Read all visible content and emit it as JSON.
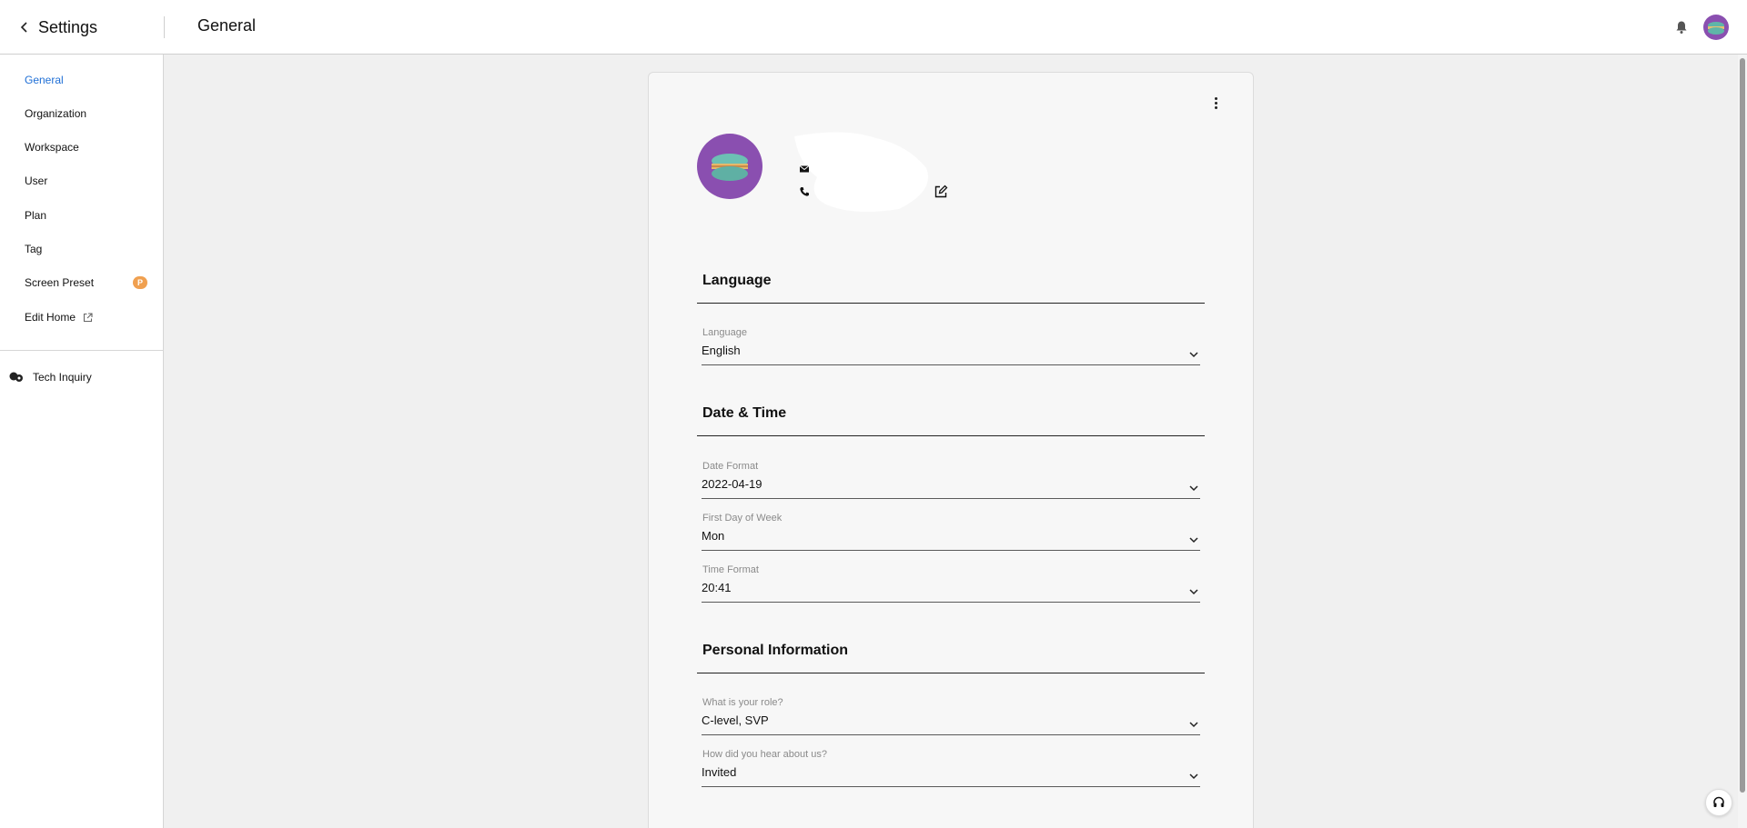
{
  "header": {
    "back_label": "Settings",
    "page_title": "General"
  },
  "sidebar": {
    "items": [
      {
        "label": "General",
        "active": true
      },
      {
        "label": "Organization"
      },
      {
        "label": "Workspace"
      },
      {
        "label": "User"
      },
      {
        "label": "Plan"
      },
      {
        "label": "Tag"
      },
      {
        "label": "Screen Preset",
        "badge": "P"
      },
      {
        "label": "Edit Home",
        "icon": "external-link-icon"
      }
    ],
    "tech_inquiry": "Tech Inquiry"
  },
  "sections": {
    "language": {
      "title": "Language",
      "fields": [
        {
          "label": "Language",
          "value": "English"
        }
      ]
    },
    "datetime": {
      "title": "Date & Time",
      "fields": [
        {
          "label": "Date Format",
          "value": "2022-04-19"
        },
        {
          "label": "First Day of Week",
          "value": "Mon"
        },
        {
          "label": "Time Format",
          "value": "20:41"
        }
      ]
    },
    "personal": {
      "title": "Personal Information",
      "fields": [
        {
          "label": "What is your role?",
          "value": "C-level, SVP"
        },
        {
          "label": "How did you hear about us?",
          "value": "Invited"
        }
      ]
    }
  },
  "colors": {
    "accent": "#1f6fd6",
    "avatar_bg": "#8a4fb0",
    "badge": "#f0a050"
  },
  "icons": {
    "back": "chevron-left-icon",
    "notifications": "bell-icon",
    "more": "kebab-menu-icon",
    "mail": "mail-icon",
    "phone": "phone-icon",
    "edit": "edit-icon",
    "dropdown": "chevron-down-icon",
    "support": "headset-icon",
    "tech": "tech-inquiry-icon"
  }
}
